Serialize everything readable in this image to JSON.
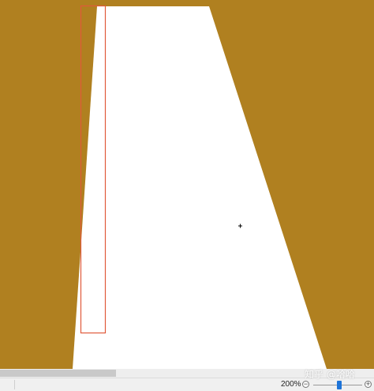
{
  "canvas": {
    "background_color": "#b08020",
    "shape_color": "#ffffff",
    "selection_color": "#e05a3a"
  },
  "status_bar": {
    "zoom_level": "200%",
    "zoom_out_icon": "minus-circle-icon",
    "zoom_in_icon": "plus-circle-icon",
    "zoom_slider_value": 0.5
  },
  "watermark": {
    "text": "知乎 @哈哈"
  }
}
